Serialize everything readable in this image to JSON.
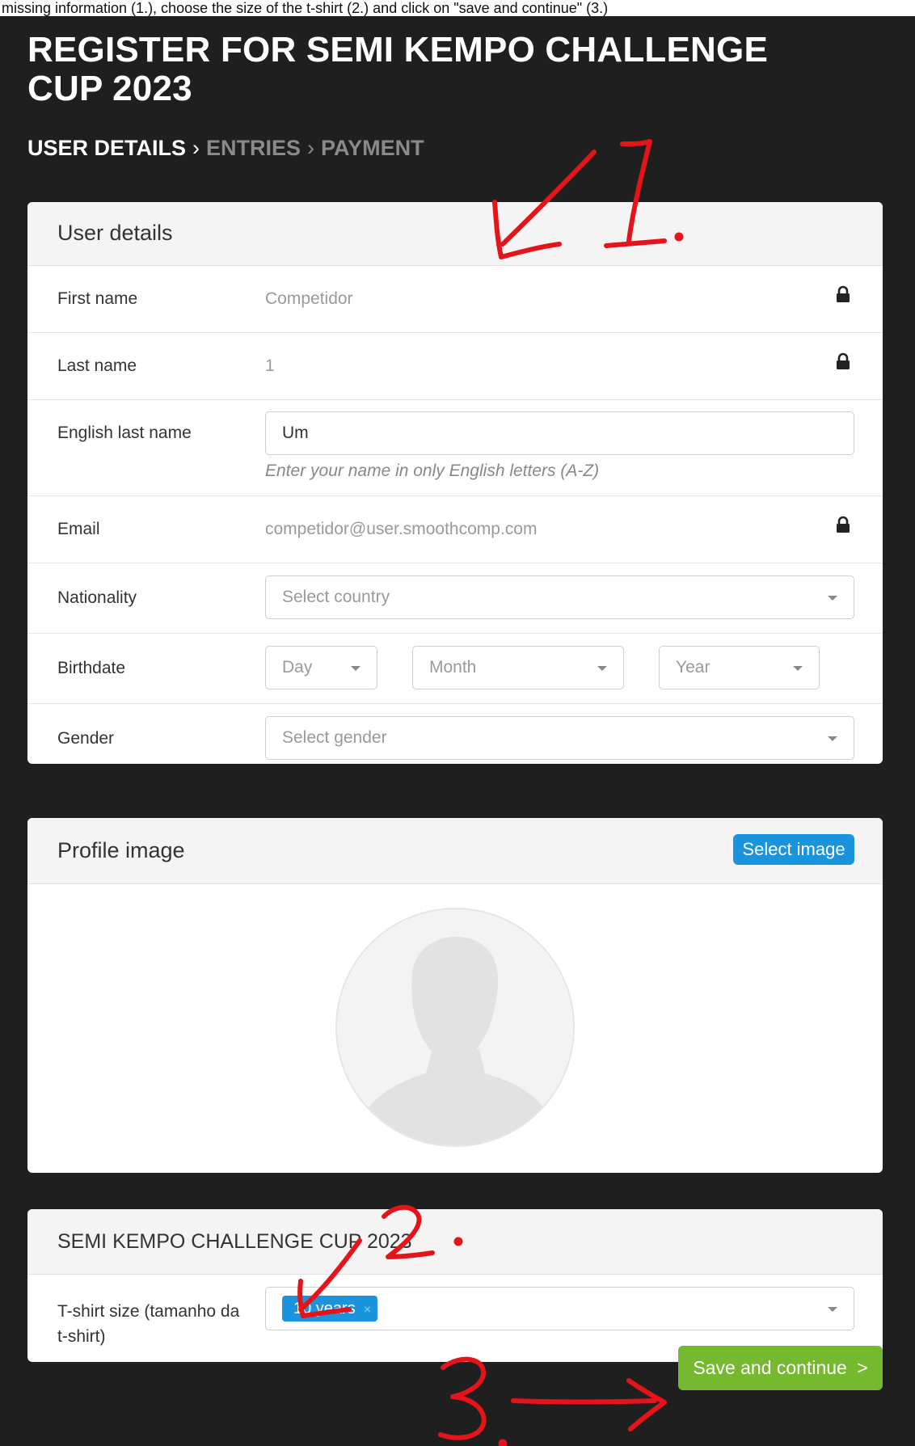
{
  "top_strip_text": "missing information (1.), choose the size of the t-shirt (2.) and click on \"save and continue\" (3.)",
  "page_title": "REGISTER FOR SEMI KEMPO CHALLENGE CUP 2023",
  "steps": {
    "step1": "USER DETAILS",
    "step2": "ENTRIES",
    "step3": "PAYMENT",
    "separator": ">"
  },
  "user_details": {
    "title": "User details",
    "first_name": {
      "label": "First name",
      "value": "Competidor",
      "locked": true
    },
    "last_name": {
      "label": "Last name",
      "value": "1",
      "locked": true
    },
    "english_last_name": {
      "label": "English last name",
      "value": "Um",
      "help": "Enter your name in only English letters (A-Z)"
    },
    "email": {
      "label": "Email",
      "value": "competidor@user.smoothcomp.com",
      "locked": true
    },
    "nationality": {
      "label": "Nationality",
      "placeholder": "Select country"
    },
    "birthdate": {
      "label": "Birthdate",
      "day": "Day",
      "month": "Month",
      "year": "Year"
    },
    "gender": {
      "label": "Gender",
      "placeholder": "Select gender"
    }
  },
  "profile_image": {
    "title": "Profile image",
    "button": "Select image"
  },
  "event": {
    "title": "SEMI KEMPO CHALLENGE CUP 2023",
    "tshirt_label": "T-shirt size (tamanho da t-shirt)",
    "tshirt_value": "10 years",
    "tag_remove": "×"
  },
  "save_button": "Save and continue",
  "save_chevron": ">",
  "colors": {
    "background": "#1f1f1f",
    "primary_blue": "#1a94dc",
    "success_green": "#74b92e",
    "annotation_red": "#e5141b"
  }
}
